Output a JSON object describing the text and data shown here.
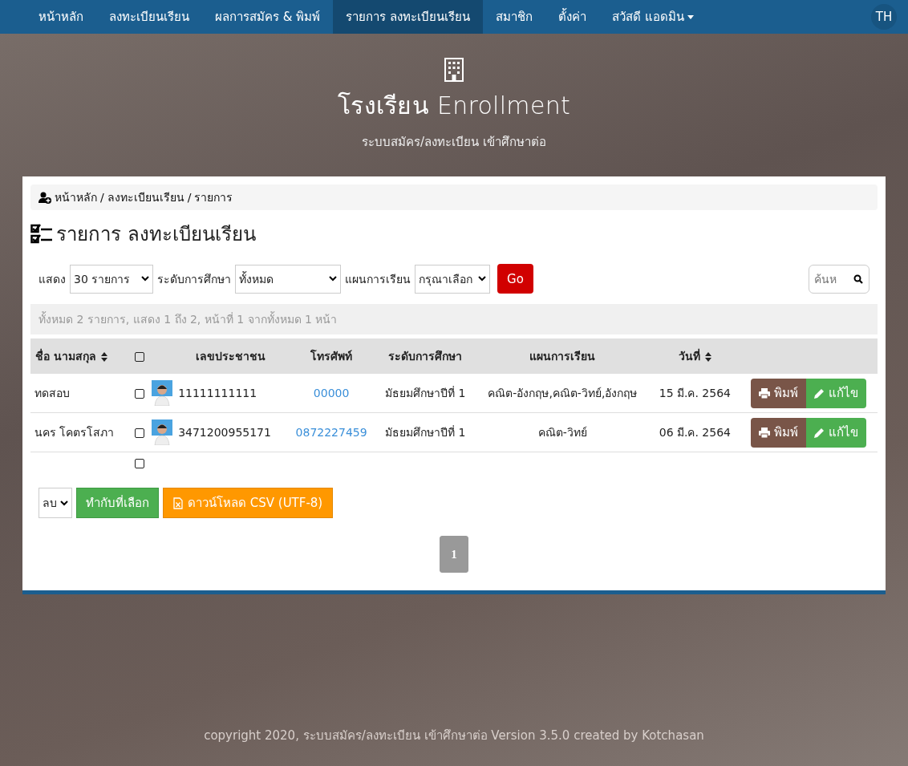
{
  "navbar": {
    "items": [
      {
        "label": "หน้าหลัก",
        "selected": false,
        "dropdown": false
      },
      {
        "label": "ลงทะเบียนเรียน",
        "selected": false,
        "dropdown": false
      },
      {
        "label": "ผลการสมัคร & พิมพ์",
        "selected": false,
        "dropdown": false
      },
      {
        "label": "รายการ ลงทะเบียนเรียน",
        "selected": true,
        "dropdown": false
      },
      {
        "label": "สมาชิก",
        "selected": false,
        "dropdown": false
      },
      {
        "label": "ตั้งค่า",
        "selected": false,
        "dropdown": false
      },
      {
        "label": "สวัสดี แอดมิน",
        "selected": false,
        "dropdown": true
      }
    ],
    "language": "TH"
  },
  "header": {
    "title": "โรงเรียน Enrollment",
    "subtitle": "ระบบสมัคร/ลงทะเบียน เข้าศึกษาต่อ"
  },
  "breadcrumb": [
    "หน้าหลัก",
    "ลงทะเบียนเรียน",
    "รายการ"
  ],
  "breadcrumb_separator": "/",
  "page_title": "รายการ ลงทะเบียนเรียน",
  "filters": [
    {
      "label": "แสดง",
      "value": "30 รายการ",
      "kind": "select"
    },
    {
      "label": "ระดับการศึกษา",
      "value": "ทั้งหมด",
      "kind": "select"
    },
    {
      "label": "แผนการเรียน",
      "value": "กรุณาเลือก",
      "kind": "select"
    }
  ],
  "go_button": "Go",
  "search": {
    "placeholder": "ค้นห"
  },
  "summary": "ทั้งหมด 2 รายการ, แสดง 1 ถึง 2, หน้าที่ 1 จากทั้งหมด 1 หน้า",
  "table": {
    "columns": [
      {
        "label": "ชื่อ นามสกุล",
        "sortable": true,
        "kind": "text"
      },
      {
        "kind": "checkbox",
        "checked": false
      },
      {
        "kind": "photo"
      },
      {
        "label": "เลขประชาชน",
        "sortable": false,
        "kind": "text"
      },
      {
        "label": "โทรศัพท์",
        "sortable": false,
        "kind": "text"
      },
      {
        "label": "ระดับการศึกษา",
        "sortable": false,
        "kind": "text"
      },
      {
        "label": "แผนการเรียน",
        "sortable": false,
        "kind": "text"
      },
      {
        "label": "วันที่",
        "sortable": true,
        "kind": "text"
      },
      {
        "kind": "actions"
      }
    ],
    "rows": [
      {
        "name": "ทดสอบ",
        "checked": false,
        "id_number": "11111111111",
        "phone": "00000",
        "level": "มัธยมศึกษาปีที่ 1",
        "plan": "คณิต-อังกฤษ,คณิต-วิทย์,อังกฤษ",
        "date": "15 มี.ค. 2564",
        "print": "พิมพ์",
        "edit": "แก้ไข"
      },
      {
        "name": "นคร โคตรโสภา",
        "checked": false,
        "id_number": "3471200955171",
        "phone": "0872227459",
        "level": "มัธยมศึกษาปีที่ 1",
        "plan": "คณิต-วิทย์",
        "date": "06 มี.ค. 2564",
        "print": "พิมพ์",
        "edit": "แก้ไข"
      }
    ],
    "footer_checked": false
  },
  "bulk_action": {
    "value": "ลบ",
    "apply": "ทำกับที่เลือก",
    "download": "ดาวน์โหลด CSV (UTF-8)"
  },
  "pagination": [
    {
      "label": "1",
      "selected": true
    }
  ],
  "footer": "copyright 2020, ระบบสมัคร/ลงทะเบียน เข้าศึกษาต่อ Version 3.5.0 created by Kotchasan"
}
